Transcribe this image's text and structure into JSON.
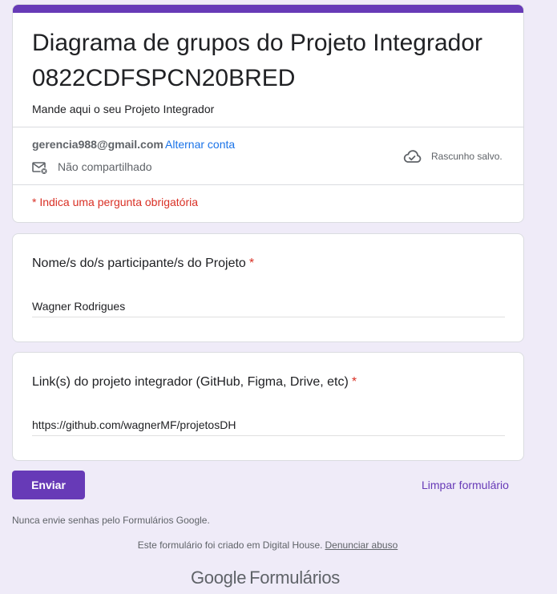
{
  "form": {
    "title": "Diagrama de grupos do Projeto Integrador 0822CDFSPCN20BRED",
    "description": "Mande aqui o seu Projeto Integrador",
    "accent_color": "#673ab7"
  },
  "account": {
    "email": "gerencia988@gmail.com",
    "switch_label": "Alternar conta",
    "sharing_status": "Não compartilhado",
    "draft_status": "Rascunho salvo."
  },
  "required_note": "* Indica uma pergunta obrigatória",
  "questions": [
    {
      "title": "Nome/s do/s participante/s do Projeto",
      "required_mark": "*",
      "answer": "Wagner Rodrigues"
    },
    {
      "title": "Link(s) do projeto integrador (GitHub, Figma, Drive, etc)",
      "required_mark": "*",
      "answer": "https://github.com/wagnerMF/projetosDH"
    }
  ],
  "actions": {
    "submit_label": "Enviar",
    "clear_label": "Limpar formulário"
  },
  "footer": {
    "password_warning": "Nunca envie senhas pelo Formulários Google.",
    "created_in": "Este formulário foi criado em Digital House.",
    "report_abuse": "Denunciar abuso",
    "logo_brand": "Google",
    "logo_product": "Formulários"
  }
}
